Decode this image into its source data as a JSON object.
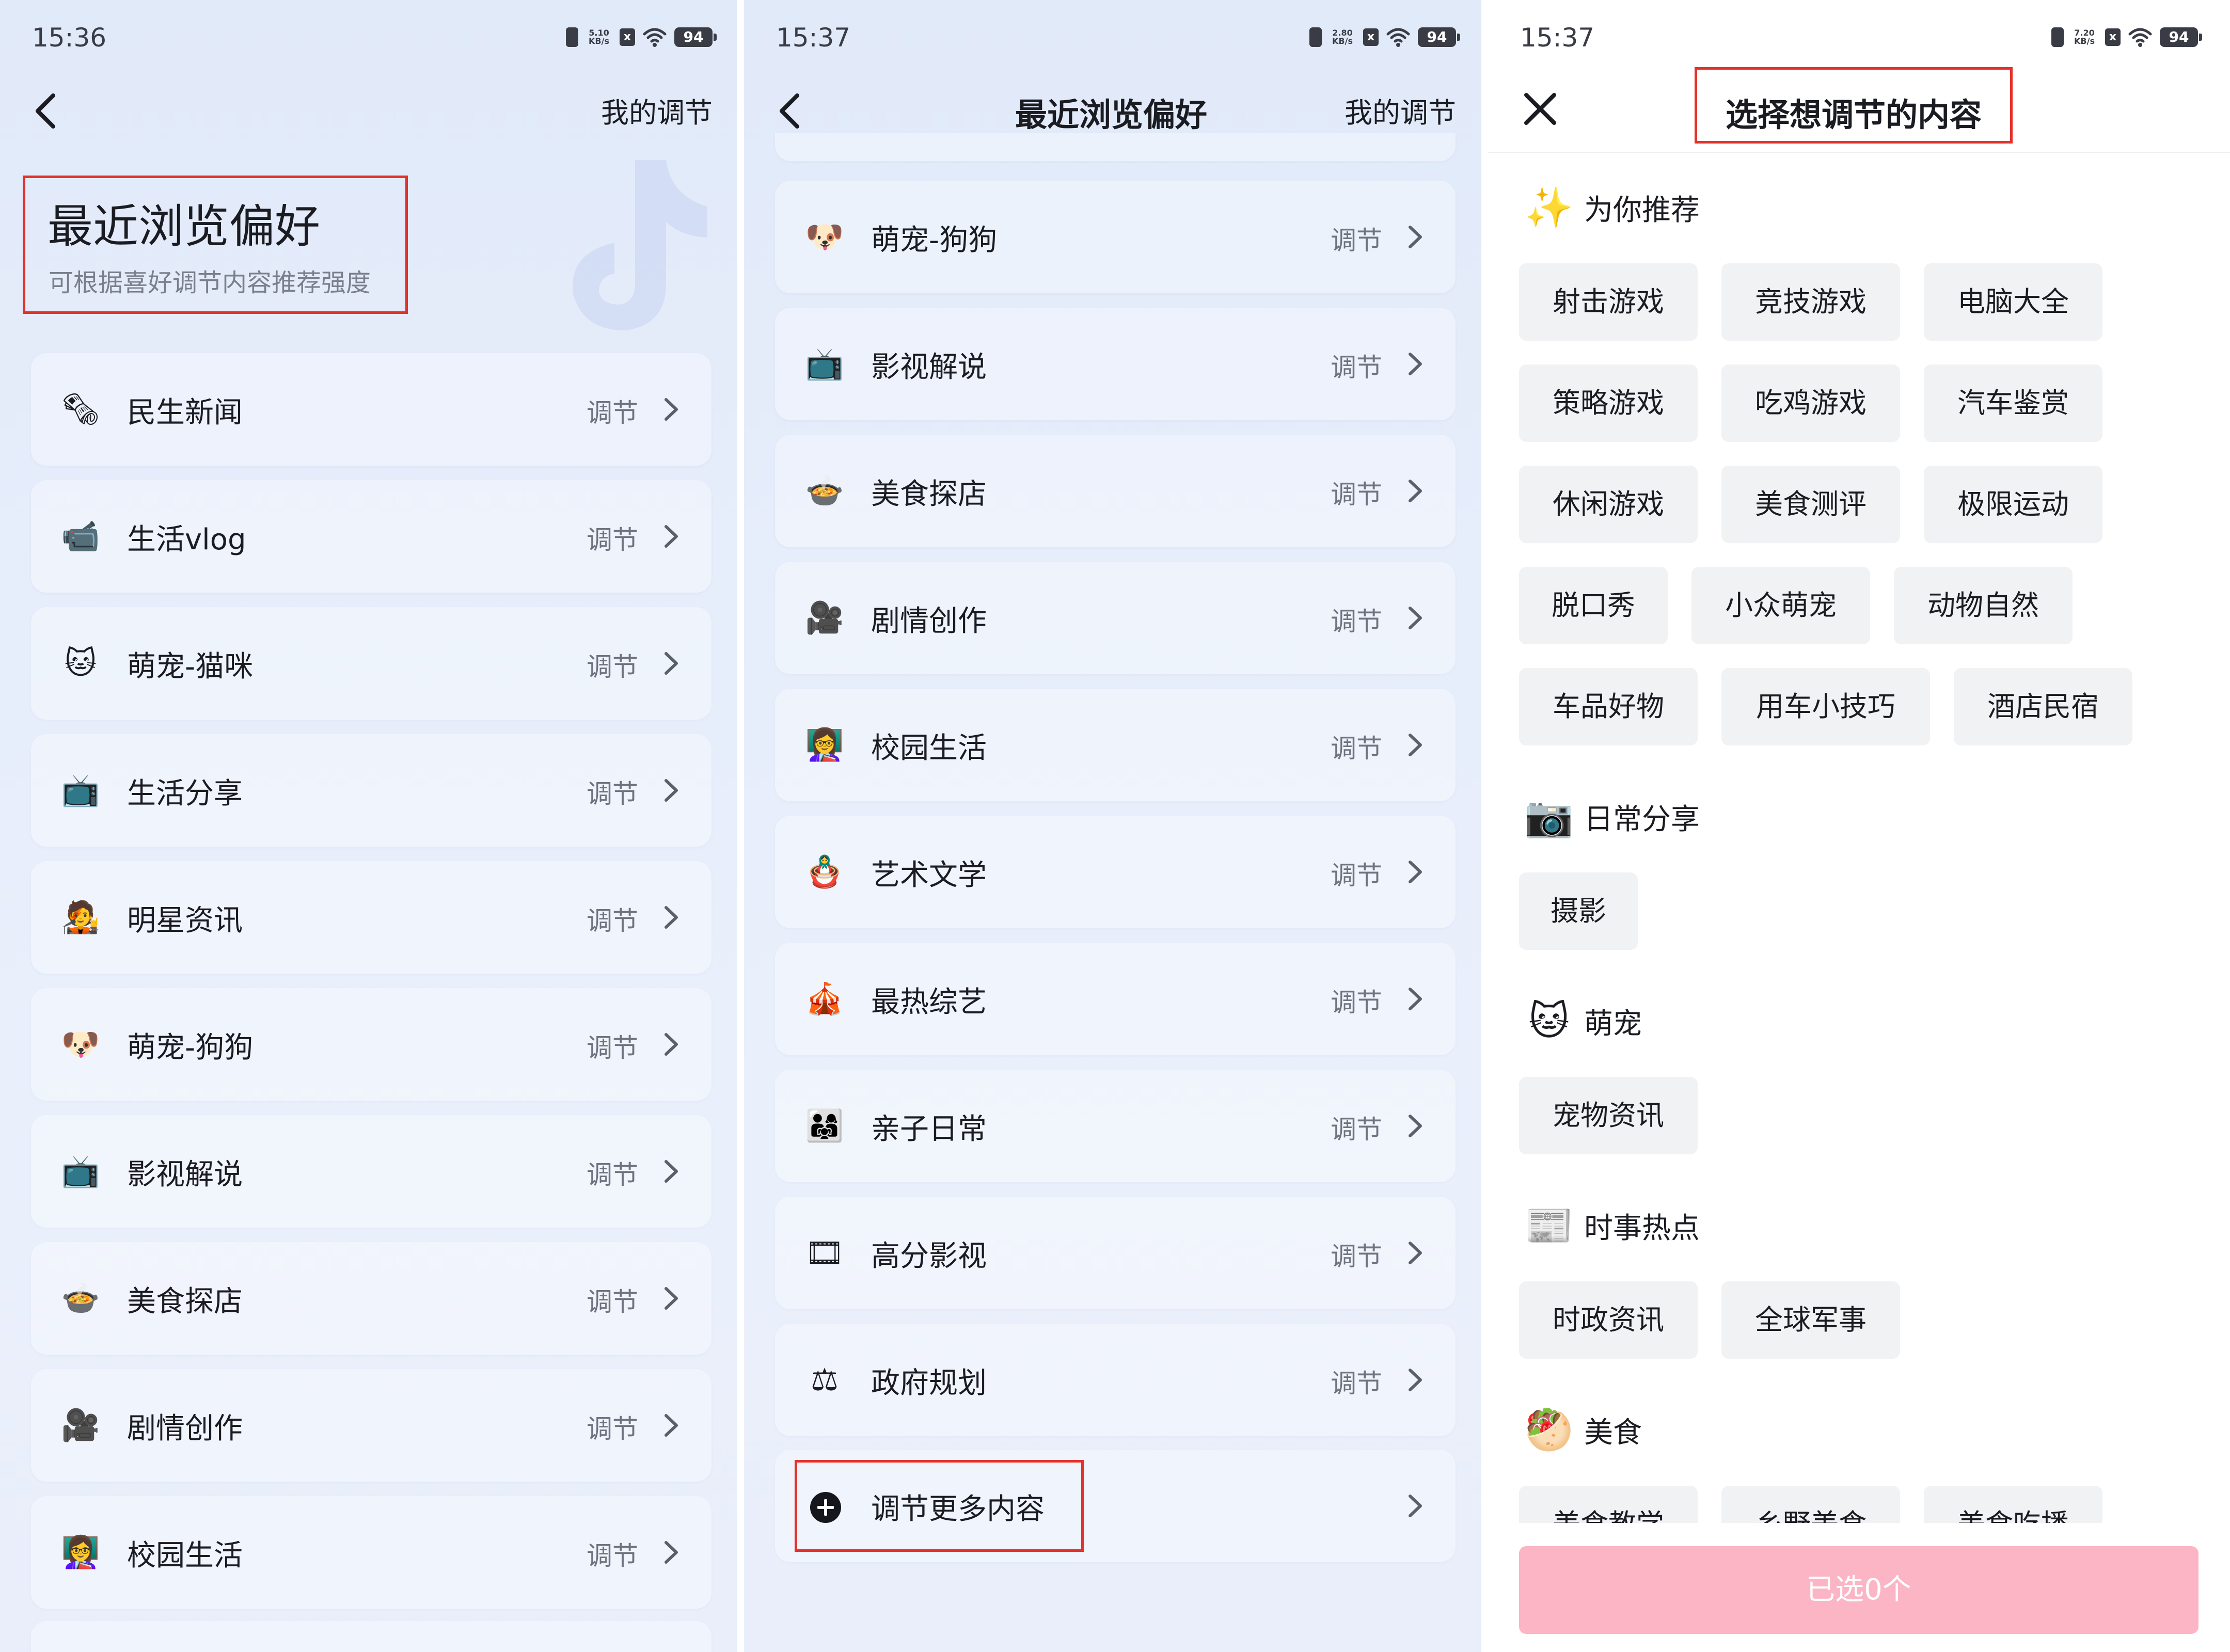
{
  "colors": {
    "accent": "#e4322b",
    "button_disabled": "#fbb5c5"
  },
  "status": {
    "s1": {
      "time": "15:36",
      "net_speed": "5.10",
      "net_unit": "KB/s",
      "battery": "94"
    },
    "s2": {
      "time": "15:37",
      "net_speed": "2.80",
      "net_unit": "KB/s",
      "battery": "94"
    },
    "s3": {
      "time": "15:37",
      "net_speed": "7.20",
      "net_unit": "KB/s",
      "battery": "94"
    }
  },
  "screen1": {
    "my_adjust": "我的调节",
    "title": "最近浏览偏好",
    "subtitle": "可根据喜好调节内容推荐强度",
    "adjust_label": "调节",
    "items": [
      {
        "label": "民生新闻",
        "icon": "🗞"
      },
      {
        "label": "生活vlog",
        "icon": "📹"
      },
      {
        "label": "萌宠-猫咪",
        "icon": "🐱"
      },
      {
        "label": "生活分享",
        "icon": "📺"
      },
      {
        "label": "明星资讯",
        "icon": "🧑‍🎤"
      },
      {
        "label": "萌宠-狗狗",
        "icon": "🐶"
      },
      {
        "label": "影视解说",
        "icon": "📺"
      },
      {
        "label": "美食探店",
        "icon": "🍲"
      },
      {
        "label": "剧情创作",
        "icon": "🎥"
      },
      {
        "label": "校园生活",
        "icon": "👩‍🏫"
      }
    ]
  },
  "screen2": {
    "title": "最近浏览偏好",
    "my_adjust": "我的调节",
    "adjust_label": "调节",
    "items": [
      {
        "label": "萌宠-狗狗",
        "icon": "🐶"
      },
      {
        "label": "影视解说",
        "icon": "📺"
      },
      {
        "label": "美食探店",
        "icon": "🍲"
      },
      {
        "label": "剧情创作",
        "icon": "🎥"
      },
      {
        "label": "校园生活",
        "icon": "👩‍🏫"
      },
      {
        "label": "艺术文学",
        "icon": "🪆"
      },
      {
        "label": "最热综艺",
        "icon": "🎪"
      },
      {
        "label": "亲子日常",
        "icon": "👨‍👩‍👧"
      },
      {
        "label": "高分影视",
        "icon": "🎞"
      },
      {
        "label": "政府规划",
        "icon": "⚖"
      }
    ],
    "more": {
      "label": "调节更多内容",
      "icon": "plus-circle-icon"
    }
  },
  "screen3": {
    "title": "选择想调节的内容",
    "sections": [
      {
        "title": "为你推荐",
        "icon": "✨",
        "tags": [
          "射击游戏",
          "竞技游戏",
          "电脑大全",
          "策略游戏",
          "吃鸡游戏",
          "汽车鉴赏",
          "休闲游戏",
          "美食测评",
          "极限运动",
          "脱口秀",
          "小众萌宠",
          "动物自然",
          "车品好物",
          "用车小技巧",
          "酒店民宿"
        ]
      },
      {
        "title": "日常分享",
        "icon": "📷",
        "tags": [
          "摄影"
        ]
      },
      {
        "title": "萌宠",
        "icon": "🐱",
        "tags": [
          "宠物资讯"
        ]
      },
      {
        "title": "时事热点",
        "icon": "📰",
        "tags": [
          "时政资讯",
          "全球军事"
        ]
      },
      {
        "title": "美食",
        "icon": "🥙",
        "tags": [
          "美食教学",
          "乡野美食",
          "美食吃播"
        ]
      }
    ],
    "button": "已选0个"
  }
}
